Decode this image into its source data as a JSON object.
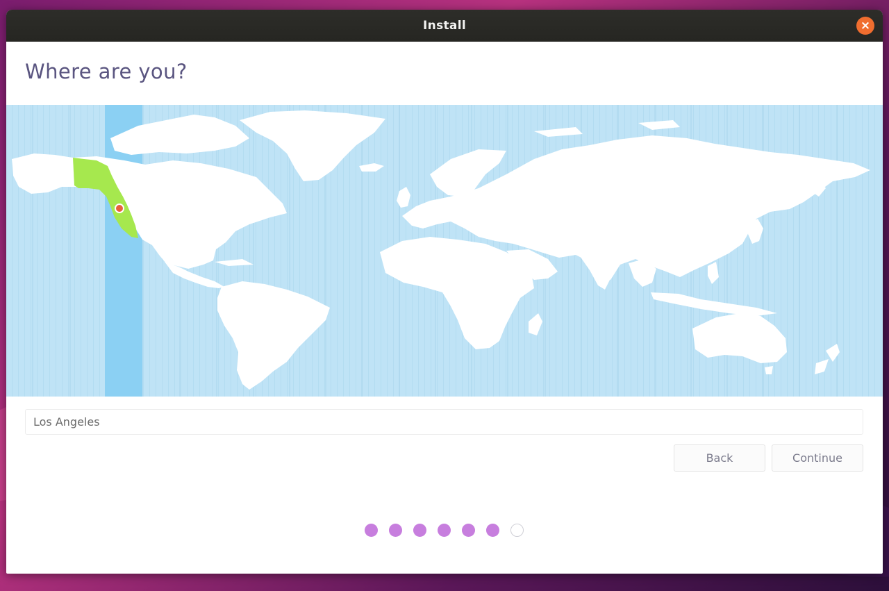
{
  "window": {
    "title": "Install",
    "close_label": "×"
  },
  "page": {
    "heading": "Where are you?"
  },
  "timezone": {
    "value": "Los Angeles"
  },
  "buttons": {
    "back": "Back",
    "continue": "Continue"
  },
  "progress": {
    "steps_completed": 6,
    "steps_total": 7
  },
  "colors": {
    "accent": "#c77ede",
    "highlight_region": "#a6e84e",
    "selected_band": "#8bd0f3",
    "ocean": "#bfe3f6",
    "marker": "#e8603c"
  }
}
